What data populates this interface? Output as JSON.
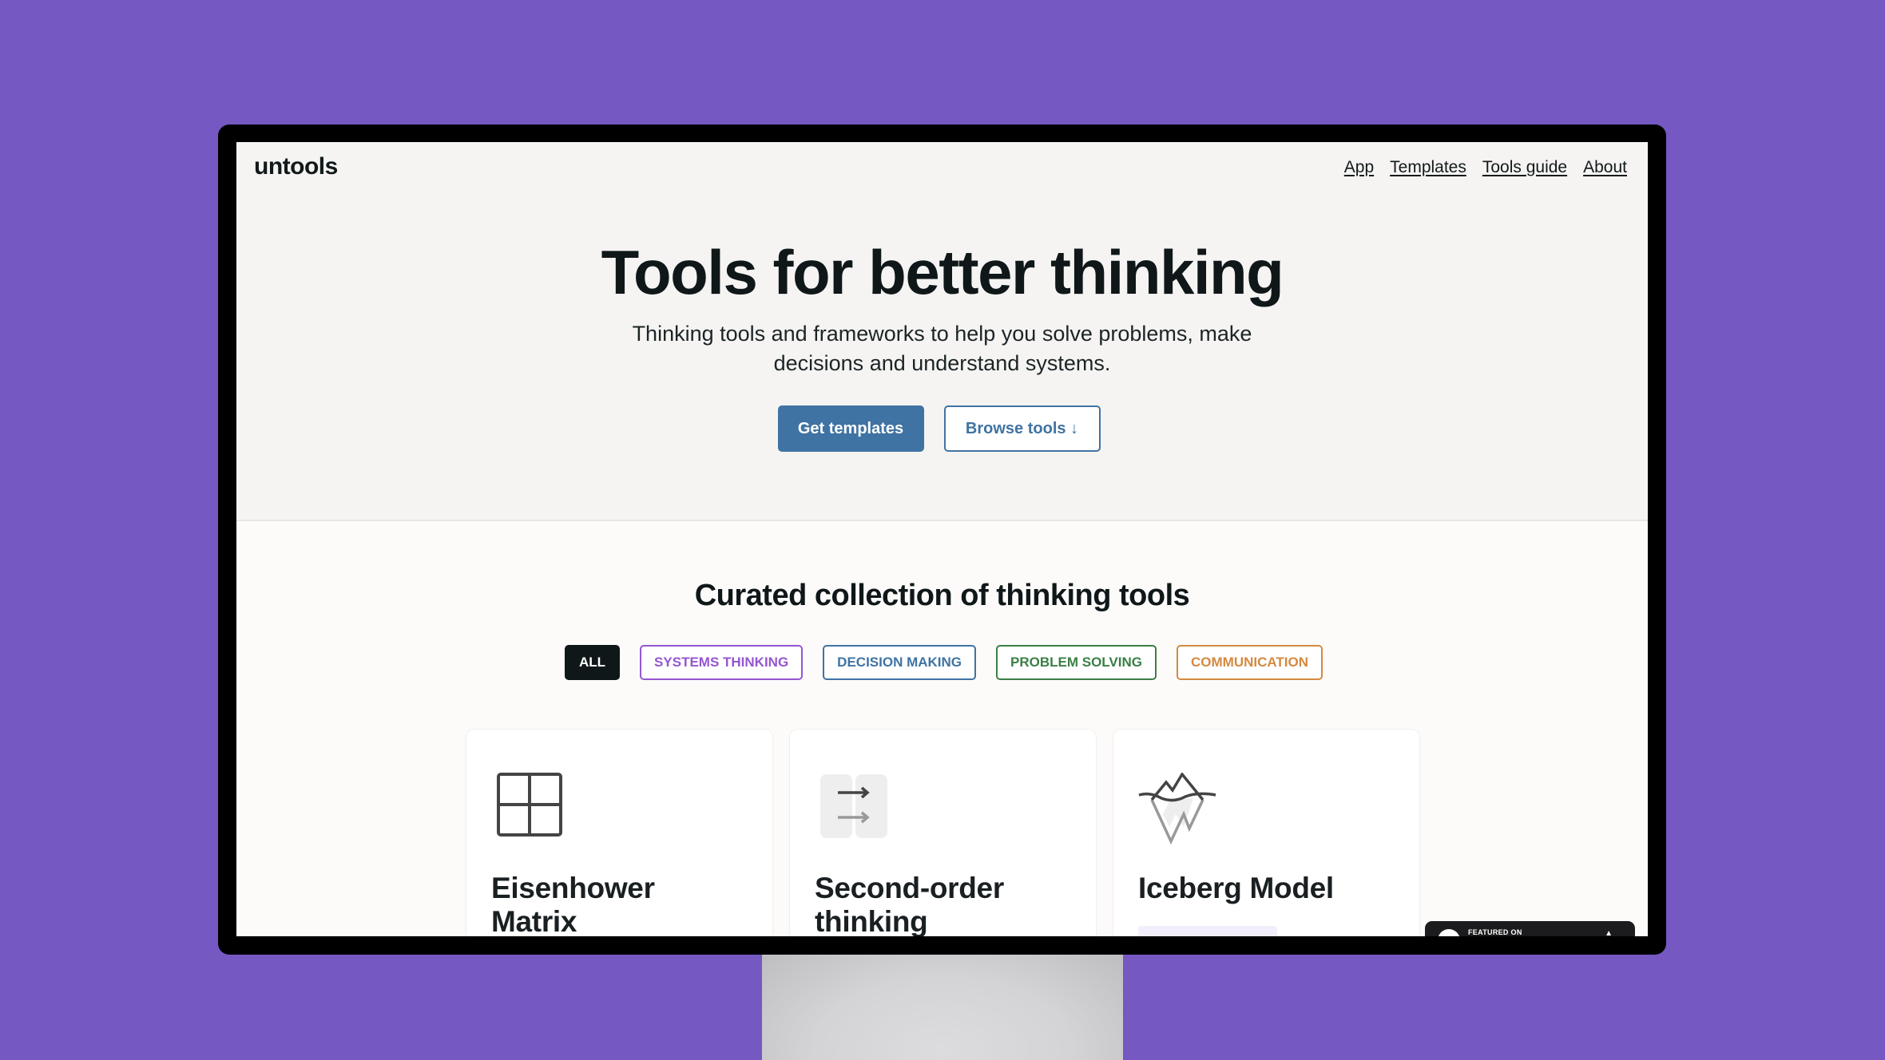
{
  "brand": {
    "logo": "untools",
    "background_color": "#7558c2"
  },
  "nav": {
    "items": [
      {
        "label": "App"
      },
      {
        "label": "Templates"
      },
      {
        "label": "Tools guide"
      },
      {
        "label": "About"
      }
    ]
  },
  "hero": {
    "title": "Tools for better thinking",
    "subtitle": "Thinking tools and frameworks to help you solve problems, make decisions and understand systems.",
    "primary_button": "Get templates",
    "secondary_button": "Browse tools ↓",
    "accent_color": "#3f73a3"
  },
  "collection": {
    "title": "Curated collection of thinking tools",
    "filters": [
      {
        "label": "ALL",
        "color": "#0f1719",
        "active": true
      },
      {
        "label": "SYSTEMS THINKING",
        "color": "#9456d0",
        "active": false
      },
      {
        "label": "DECISION MAKING",
        "color": "#3f73a3",
        "active": false
      },
      {
        "label": "PROBLEM SOLVING",
        "color": "#3a7f45",
        "active": false
      },
      {
        "label": "COMMUNICATION",
        "color": "#d4893f",
        "active": false
      }
    ],
    "cards": [
      {
        "title": "Eisenhower Matrix",
        "icon": "grid-matrix-icon"
      },
      {
        "title": "Second-order thinking",
        "icon": "double-arrow-icon"
      },
      {
        "title": "Iceberg Model",
        "icon": "iceberg-icon"
      }
    ]
  },
  "featured_badge": {
    "label": "FEATURED ON"
  }
}
